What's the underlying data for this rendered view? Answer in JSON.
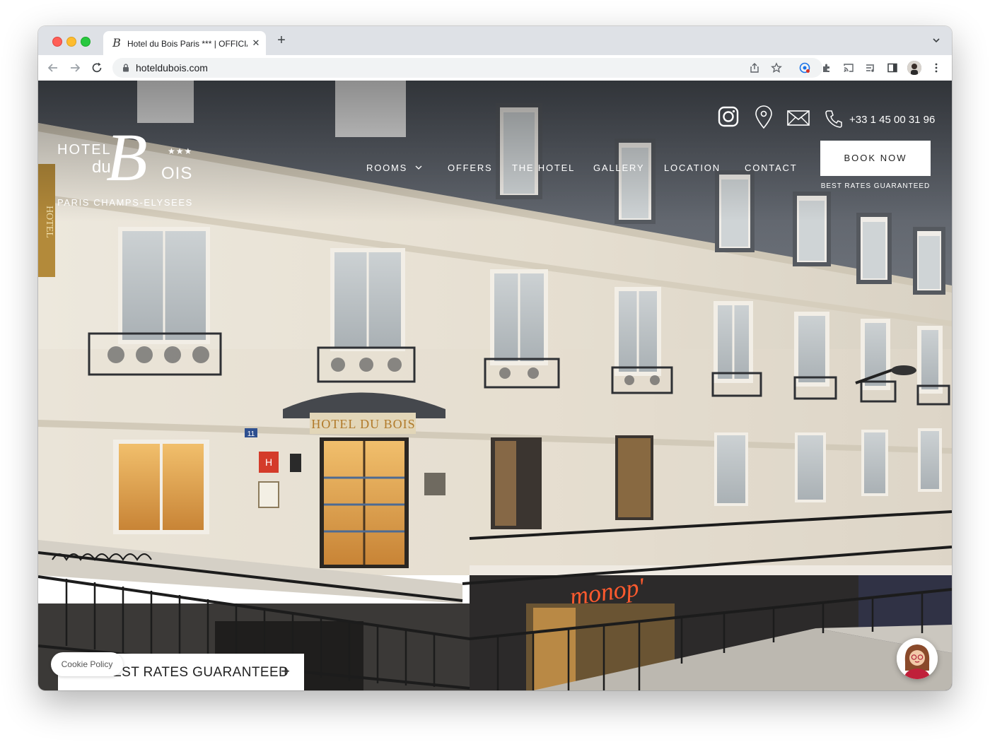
{
  "browser": {
    "tab_title": "Hotel du Bois Paris *** | OFFICIAL SITE",
    "tab_favicon": "B",
    "new_tab": "+",
    "tab_close": "✕",
    "url": "hoteldubois.com"
  },
  "site": {
    "logo": {
      "hotel": "HOTEL",
      "du": "du",
      "b": "B",
      "ois": "OIS",
      "stars": "★★★",
      "subtitle": "PARIS CHAMPS-ELYSEES"
    },
    "nav": {
      "rooms": "ROOMS",
      "offers": "OFFERS",
      "the_hotel": "THE HOTEL",
      "gallery": "GALLERY",
      "location": "LOCATION",
      "contact": "CONTACT"
    },
    "phone": "+33 1 45 00 31 96",
    "book_now": "BOOK NOW",
    "best_rates_small": "BEST RATES GUARANTEED",
    "best_rates_bar": "BEST RATES GUARANTEED",
    "best_rates_toggle": "+",
    "cookie_policy": "Cookie Policy",
    "storefront_sign": "monop'",
    "facade_sign": "HOTEL DU BOIS",
    "street_number": "11",
    "hotel_plaque": "H",
    "vertical_sign": "HOTEL"
  },
  "colors": {
    "facade": "#e7e1d4",
    "roof": "#62676f",
    "window_glass": "#bfc5c9",
    "warm_light": "#e2a14d",
    "neon": "#ff5a2e",
    "railing": "#1c1c1c"
  },
  "icons": [
    "instagram-icon",
    "location-pin-icon",
    "mail-icon",
    "phone-icon",
    "chevron-down-icon",
    "lock-icon",
    "share-icon",
    "star-icon",
    "extensions-icon",
    "cast-icon",
    "reading-list-icon",
    "side-panel-icon",
    "more-icon"
  ]
}
